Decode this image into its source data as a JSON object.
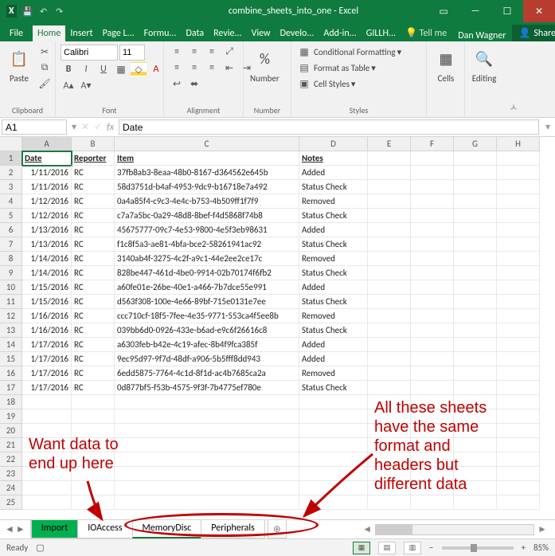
{
  "window": {
    "title": "combine_sheets_into_one - Excel",
    "user": "Dan Wagner",
    "share": "Share"
  },
  "ribbonTabs": [
    "File",
    "Home",
    "Insert",
    "Page L...",
    "Formu...",
    "Data",
    "Revie...",
    "View",
    "Develo...",
    "Add-in...",
    "GILLH...",
    "Tell me"
  ],
  "activeRibbonTab": "Home",
  "ribbon": {
    "clipboard": {
      "label": "Clipboard",
      "paste": "Paste"
    },
    "font": {
      "label": "Font",
      "name": "Calibri",
      "size": "11"
    },
    "alignment": {
      "label": "Alignment"
    },
    "number": {
      "label": "Number",
      "format": "Number"
    },
    "styles": {
      "label": "Styles",
      "conditional": "Conditional Formatting",
      "table": "Format as Table",
      "cell": "Cell Styles"
    },
    "cells": {
      "label": "Cells"
    },
    "editing": {
      "label": "Editing"
    }
  },
  "nameBox": "A1",
  "formulaBar": "Date",
  "columns": [
    "A",
    "B",
    "C",
    "D",
    "E",
    "F",
    "G",
    "H"
  ],
  "headers": [
    "Date",
    "Reporter",
    "Item",
    "Notes"
  ],
  "rows": [
    {
      "n": 2,
      "date": "1/11/2016",
      "rep": "RC",
      "item": "37fb8ab3-8eaa-48b0-8167-d364562e645b",
      "note": "Added"
    },
    {
      "n": 3,
      "date": "1/11/2016",
      "rep": "RC",
      "item": "58d3751d-b4af-4953-9dc9-b16718e7a492",
      "note": "Status Check"
    },
    {
      "n": 4,
      "date": "1/12/2016",
      "rep": "RC",
      "item": "0a4a85f4-c9c3-4e4c-b753-4b509ff1f7f9",
      "note": "Removed"
    },
    {
      "n": 5,
      "date": "1/12/2016",
      "rep": "RC",
      "item": "c7a7a5bc-0a29-48d8-8bef-f4d5868f74b8",
      "note": "Status Check"
    },
    {
      "n": 6,
      "date": "1/13/2016",
      "rep": "RC",
      "item": "45675777-09c7-4e53-9800-4e5f3eb98631",
      "note": "Added"
    },
    {
      "n": 7,
      "date": "1/13/2016",
      "rep": "RC",
      "item": "f1c8f5a3-ae81-4bfa-bce2-58261941ac92",
      "note": "Status Check"
    },
    {
      "n": 8,
      "date": "1/14/2016",
      "rep": "RC",
      "item": "3140ab4f-3275-4c2f-a9c1-44e2ee2ce17c",
      "note": "Removed"
    },
    {
      "n": 9,
      "date": "1/14/2016",
      "rep": "RC",
      "item": "828be447-461d-4be0-9914-02b70174f6fb2",
      "note": "Status Check"
    },
    {
      "n": 10,
      "date": "1/15/2016",
      "rep": "RC",
      "item": "a60fe01e-26be-40e1-a466-7b7dce55e991",
      "note": "Added"
    },
    {
      "n": 11,
      "date": "1/15/2016",
      "rep": "RC",
      "item": "d563f308-100e-4e66-89bf-715e0131e7ee",
      "note": "Status Check"
    },
    {
      "n": 12,
      "date": "1/16/2016",
      "rep": "RC",
      "item": "ccc710cf-18f5-7fee-4e35-9771-553ca4f5ee8b",
      "note": "Removed"
    },
    {
      "n": 13,
      "date": "1/16/2016",
      "rep": "RC",
      "item": "039bb6d0-0926-433e-b6ad-e9c6f26616c8",
      "note": "Status Check"
    },
    {
      "n": 14,
      "date": "1/17/2016",
      "rep": "RC",
      "item": "a6303feb-b42e-4c19-afec-8b4f9fca385f",
      "note": "Added"
    },
    {
      "n": 15,
      "date": "1/17/2016",
      "rep": "RC",
      "item": "9ec95d97-9f7d-48df-a906-5b5fff8dd943",
      "note": "Added"
    },
    {
      "n": 16,
      "date": "1/17/2016",
      "rep": "RC",
      "item": "6edd5875-7764-4c1d-8f1d-ac4b7685ca2a",
      "note": "Removed"
    },
    {
      "n": 17,
      "date": "1/17/2016",
      "rep": "RC",
      "item": "0d877bf5-f53b-4575-9f3f-7b4775ef780e",
      "note": "Status Check"
    }
  ],
  "emptyRows": [
    18,
    19,
    20,
    21,
    22,
    23,
    24,
    25
  ],
  "sheetTabs": [
    "Import",
    "IOAccess",
    "MemoryDisc",
    "Peripherals"
  ],
  "activeSheet": "MemoryDisc",
  "status": {
    "ready": "Ready",
    "zoom": "85%"
  },
  "annotations": {
    "left": "Want data to\nend up here",
    "right": "All these sheets\nhave the same\nformat and\nheaders but\ndifferent data"
  }
}
